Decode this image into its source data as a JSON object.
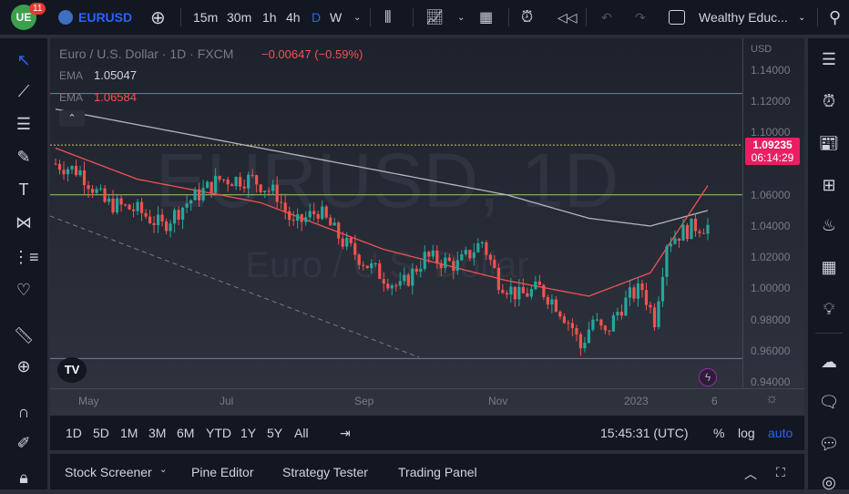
{
  "toolbar": {
    "badge": "11",
    "symbol": "EURUSD",
    "intervals": [
      "15m",
      "30m",
      "1h",
      "4h",
      "D",
      "W"
    ],
    "layout_name": "Wealthy Educ..."
  },
  "legend": {
    "title": "Euro / U.S. Dollar · 1D · FXCM",
    "change": "−0.00647 (−0.59%)",
    "ema1_label": "EMA",
    "ema1_value": "1.05047",
    "ema2_label": "EMA",
    "ema2_value": "1.06584"
  },
  "watermark": {
    "line1": "EURUSD, 1D",
    "line2": "Euro / U.S. Dollar"
  },
  "price_scale": {
    "currency": "USD",
    "ticks": [
      "1.14000",
      "1.12000",
      "1.10000",
      "1.06000",
      "1.04000",
      "1.02000",
      "1.00000",
      "0.98000",
      "0.96000",
      "0.94000"
    ],
    "last_price": "1.09235",
    "countdown": "06:14:29"
  },
  "time_scale": {
    "labels": [
      "May",
      "Jul",
      "Sep",
      "Nov",
      "2023",
      "6"
    ]
  },
  "bottom": {
    "ranges": [
      "1D",
      "5D",
      "1M",
      "3M",
      "6M",
      "YTD",
      "1Y",
      "5Y",
      "All"
    ],
    "clock": "15:45:31 (UTC)",
    "percent": "%",
    "log": "log",
    "auto": "auto"
  },
  "panel": {
    "tabs": [
      "Stock Screener",
      "Pine Editor",
      "Strategy Tester",
      "Trading Panel"
    ]
  },
  "colors": {
    "up": "#26a69a",
    "down": "#ef5350",
    "accent": "#2962ff",
    "last": "#e91e63"
  },
  "chart_data": {
    "type": "candlestick",
    "ylim": [
      0.93,
      1.15
    ],
    "candle_count": 160,
    "close_anchors": [
      [
        0,
        1.08
      ],
      [
        6,
        1.075
      ],
      [
        12,
        1.055
      ],
      [
        20,
        1.05
      ],
      [
        26,
        1.04
      ],
      [
        32,
        1.055
      ],
      [
        40,
        1.07
      ],
      [
        48,
        1.07
      ],
      [
        54,
        1.06
      ],
      [
        58,
        1.04
      ],
      [
        64,
        1.05
      ],
      [
        70,
        1.03
      ],
      [
        76,
        1.015
      ],
      [
        84,
        1.0
      ],
      [
        90,
        1.02
      ],
      [
        98,
        1.015
      ],
      [
        104,
        1.03
      ],
      [
        108,
        1.005
      ],
      [
        113,
        0.995
      ],
      [
        118,
        1.0
      ],
      [
        122,
        0.99
      ],
      [
        126,
        0.975
      ],
      [
        128,
        0.962
      ],
      [
        131,
        0.98
      ],
      [
        134,
        0.97
      ],
      [
        137,
        0.985
      ],
      [
        140,
        0.995
      ],
      [
        143,
        1.0
      ],
      [
        146,
        0.98
      ],
      [
        149,
        1.03
      ],
      [
        152,
        1.035
      ],
      [
        156,
        1.04
      ],
      [
        159,
        1.04
      ]
    ],
    "ema_slow": [
      [
        0,
        1.115
      ],
      [
        40,
        1.095
      ],
      [
        80,
        1.075
      ],
      [
        110,
        1.06
      ],
      [
        130,
        1.045
      ],
      [
        145,
        1.04
      ],
      [
        159,
        1.05
      ]
    ],
    "ema_fast": [
      [
        0,
        1.09
      ],
      [
        20,
        1.07
      ],
      [
        50,
        1.055
      ],
      [
        80,
        1.025
      ],
      [
        110,
        1.005
      ],
      [
        130,
        0.995
      ],
      [
        145,
        1.01
      ],
      [
        159,
        1.066
      ]
    ],
    "hlines": [
      1.125,
      1.092,
      1.06,
      0.955
    ]
  }
}
